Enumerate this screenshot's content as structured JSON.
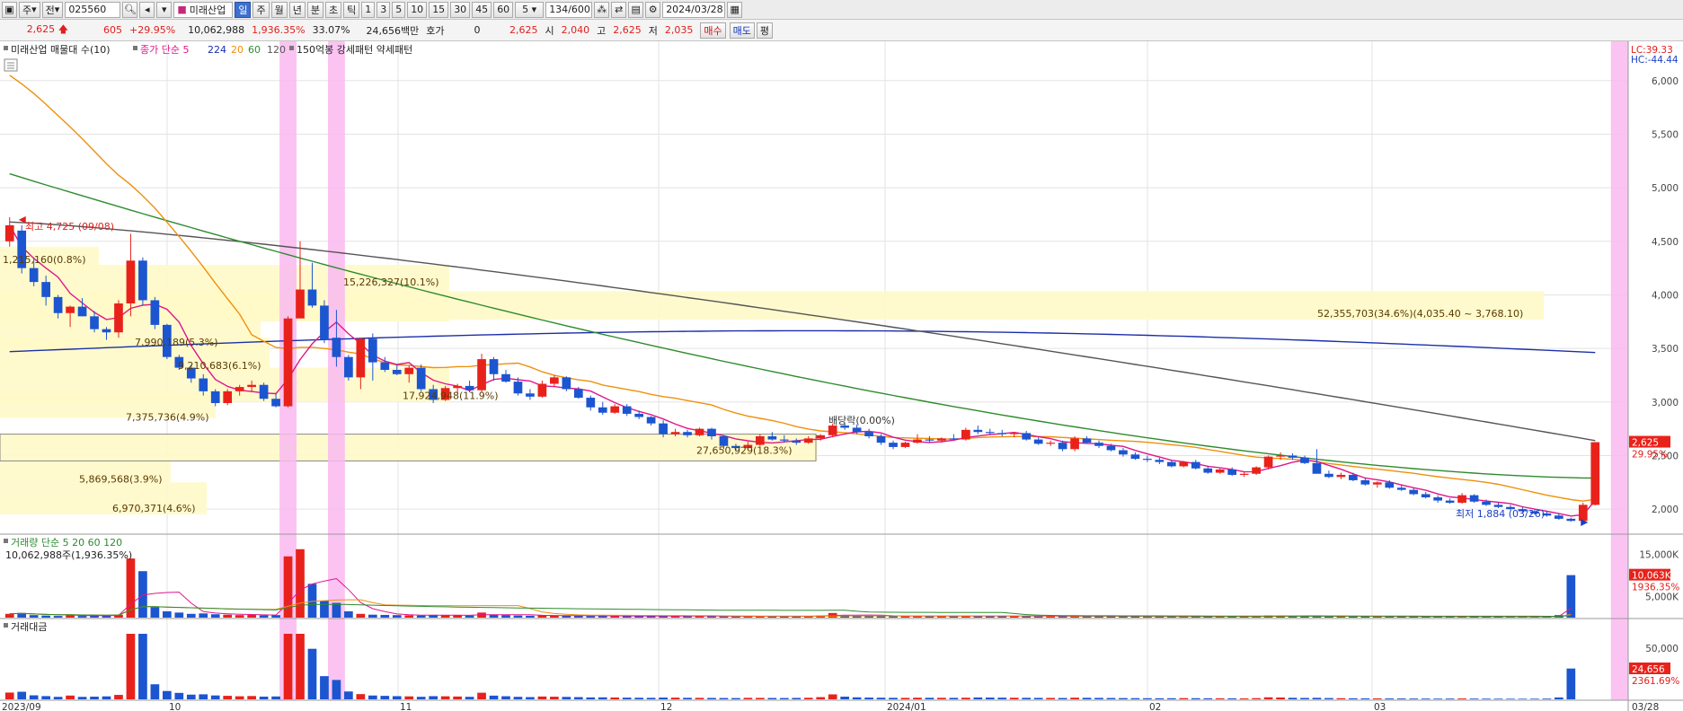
{
  "toolbar": {
    "items": [
      "주",
      "전"
    ],
    "code": "025560",
    "name": "미래산업",
    "periods": [
      "일",
      "주",
      "월",
      "년",
      "분",
      "초",
      "틱"
    ],
    "active_period": "일",
    "intervals": [
      "1",
      "3",
      "5",
      "10",
      "15",
      "30",
      "45",
      "60"
    ],
    "count_sel": "5",
    "range": "134",
    "range_total": "/600",
    "date": "2024/03/28"
  },
  "quote": {
    "price": "2,625",
    "change": "605",
    "change_pct": "+29.95%",
    "volume": "10,062,988",
    "volume_ratio": "1,936.35%",
    "turnover": "33.07%",
    "amount": "24,656백만",
    "ask_label": "호가",
    "ask_value": "0",
    "last": "2,625",
    "open_label": "시",
    "open": "2,040",
    "high_label": "고",
    "high": "2,625",
    "low_label": "저",
    "low": "2,035",
    "buy": "매수",
    "sell": "매도",
    "eval": "평"
  },
  "colors": {
    "up": "#e8221b",
    "down": "#1c55d0",
    "ma5": "#e0168a",
    "ma20": "#f0900c",
    "ma60": "#2e8b2e",
    "ma120": "#555555",
    "ma224": "#1b2fa8",
    "highlight": "#f9b9f0",
    "box": "#fff9c8"
  },
  "price_pane": {
    "title": "미래산업 매물대 수(10)",
    "legend": [
      "종가 단순 5",
      "224",
      "20",
      "60",
      "120"
    ],
    "legend2": "150억봉 강세패턴 약세패턴",
    "lc": "LC:39.33",
    "hc": "HC:-44.44",
    "y_labels": [
      "6,000",
      "5,500",
      "5,000",
      "4,500",
      "4,000",
      "3,500",
      "3,000",
      "2,500",
      "2,000"
    ],
    "last_tag": "2,625",
    "pct_tag": "29.95%",
    "high_note": "최고 4,725 (09/08)",
    "low_note": "최저 1,884 (03/26)",
    "div_note": "배당락(0.00%)",
    "volume_profile": [
      "52,355,703(34.6%)(4,035.40 ~ 3,768.10)",
      "15,226,327(10.1%)",
      "7,990,189(5.3%)",
      "9,210,683(6.1%)",
      "17,924,948(11.9%)",
      "7,375,736(4.9%)",
      "27,650,929(18.3%)",
      "5,869,568(3.9%)",
      "6,970,371(4.6%)",
      "1,215,160(0.8%)"
    ]
  },
  "volume_pane": {
    "title": "거래량 단순 5 20 60 120",
    "value": "10,062,988주(1,936.35%)",
    "y_labels": [
      "15,000K",
      "5,000K"
    ],
    "tag": "10,063K",
    "tag2": "1936.35%"
  },
  "amount_pane": {
    "title": "거래대금",
    "y_labels": [
      "50,000"
    ],
    "tag": "24,656",
    "tag2": "2361.69%"
  },
  "x_labels": [
    "2023/09",
    "10",
    "11",
    "12",
    "2024/01",
    "02",
    "03",
    "03/28"
  ],
  "chart_data": {
    "type": "candlestick",
    "title": "미래산업",
    "y_range": [
      1800,
      6300
    ],
    "candles_ohlc": [
      [
        4500,
        4725,
        4450,
        4650
      ],
      [
        4600,
        4650,
        4200,
        4250
      ],
      [
        4250,
        4350,
        4080,
        4120
      ],
      [
        4120,
        4180,
        3900,
        3980
      ],
      [
        3980,
        4000,
        3780,
        3830
      ],
      [
        3830,
        3900,
        3700,
        3890
      ],
      [
        3890,
        3970,
        3800,
        3800
      ],
      [
        3800,
        3850,
        3650,
        3680
      ],
      [
        3680,
        3700,
        3580,
        3650
      ],
      [
        3650,
        3950,
        3600,
        3920
      ],
      [
        3920,
        4570,
        3800,
        4320
      ],
      [
        4320,
        4350,
        3900,
        3950
      ],
      [
        3950,
        3980,
        3680,
        3720
      ],
      [
        3720,
        3730,
        3400,
        3420
      ],
      [
        3420,
        3440,
        3300,
        3320
      ],
      [
        3320,
        3350,
        3180,
        3220
      ],
      [
        3220,
        3260,
        3060,
        3100
      ],
      [
        3100,
        3120,
        2960,
        2990
      ],
      [
        2990,
        3120,
        2970,
        3100
      ],
      [
        3100,
        3160,
        3060,
        3140
      ],
      [
        3140,
        3200,
        3090,
        3160
      ],
      [
        3160,
        3180,
        3010,
        3030
      ],
      [
        3030,
        3080,
        2950,
        2960
      ],
      [
        2960,
        3800,
        2950,
        3780
      ],
      [
        3780,
        4500,
        3800,
        4050
      ],
      [
        4050,
        4300,
        3880,
        3900
      ],
      [
        3900,
        3950,
        3550,
        3580
      ],
      [
        3600,
        3860,
        3330,
        3420
      ],
      [
        3420,
        3440,
        3200,
        3230
      ],
      [
        3230,
        3600,
        3120,
        3590
      ],
      [
        3590,
        3640,
        3200,
        3370
      ],
      [
        3370,
        3420,
        3280,
        3300
      ],
      [
        3300,
        3350,
        3250,
        3260
      ],
      [
        3260,
        3340,
        3180,
        3320
      ],
      [
        3320,
        3350,
        3100,
        3120
      ],
      [
        3120,
        3160,
        2990,
        3020
      ],
      [
        3020,
        3150,
        3010,
        3130
      ],
      [
        3130,
        3170,
        3080,
        3150
      ],
      [
        3150,
        3200,
        3090,
        3110
      ],
      [
        3110,
        3450,
        3090,
        3400
      ],
      [
        3400,
        3420,
        3200,
        3260
      ],
      [
        3260,
        3300,
        3180,
        3190
      ],
      [
        3190,
        3230,
        3060,
        3080
      ],
      [
        3080,
        3120,
        3020,
        3050
      ],
      [
        3050,
        3200,
        3040,
        3170
      ],
      [
        3170,
        3250,
        3140,
        3230
      ],
      [
        3230,
        3240,
        3100,
        3120
      ],
      [
        3120,
        3140,
        3030,
        3040
      ],
      [
        3040,
        3060,
        2920,
        2950
      ],
      [
        2950,
        3000,
        2880,
        2900
      ],
      [
        2900,
        2980,
        2890,
        2960
      ],
      [
        2960,
        2980,
        2870,
        2890
      ],
      [
        2890,
        2920,
        2840,
        2860
      ],
      [
        2860,
        2870,
        2780,
        2800
      ],
      [
        2800,
        2830,
        2670,
        2700
      ],
      [
        2700,
        2750,
        2680,
        2720
      ],
      [
        2720,
        2740,
        2670,
        2690
      ],
      [
        2690,
        2760,
        2680,
        2750
      ],
      [
        2750,
        2760,
        2650,
        2680
      ],
      [
        2680,
        2690,
        2560,
        2590
      ],
      [
        2590,
        2610,
        2540,
        2570
      ],
      [
        2570,
        2630,
        2560,
        2600
      ],
      [
        2600,
        2700,
        2590,
        2680
      ],
      [
        2680,
        2720,
        2640,
        2650
      ],
      [
        2650,
        2690,
        2620,
        2640
      ],
      [
        2640,
        2660,
        2600,
        2620
      ],
      [
        2620,
        2680,
        2610,
        2660
      ],
      [
        2660,
        2700,
        2640,
        2690
      ],
      [
        2690,
        2800,
        2670,
        2780
      ],
      [
        2780,
        2800,
        2740,
        2760
      ],
      [
        2760,
        2790,
        2700,
        2720
      ],
      [
        2720,
        2750,
        2660,
        2680
      ],
      [
        2680,
        2700,
        2600,
        2620
      ],
      [
        2620,
        2640,
        2560,
        2580
      ],
      [
        2580,
        2630,
        2570,
        2620
      ],
      [
        2620,
        2700,
        2610,
        2650
      ],
      [
        2650,
        2680,
        2620,
        2640
      ],
      [
        2640,
        2670,
        2620,
        2660
      ],
      [
        2660,
        2700,
        2640,
        2650
      ],
      [
        2650,
        2760,
        2640,
        2740
      ],
      [
        2740,
        2780,
        2700,
        2720
      ],
      [
        2720,
        2750,
        2690,
        2710
      ],
      [
        2710,
        2740,
        2680,
        2700
      ],
      [
        2700,
        2720,
        2670,
        2710
      ],
      [
        2710,
        2730,
        2640,
        2650
      ],
      [
        2650,
        2670,
        2600,
        2610
      ],
      [
        2610,
        2640,
        2590,
        2620
      ],
      [
        2620,
        2640,
        2540,
        2560
      ],
      [
        2560,
        2680,
        2540,
        2660
      ],
      [
        2660,
        2680,
        2610,
        2620
      ],
      [
        2620,
        2640,
        2570,
        2590
      ],
      [
        2590,
        2610,
        2540,
        2550
      ],
      [
        2550,
        2570,
        2490,
        2510
      ],
      [
        2510,
        2530,
        2460,
        2470
      ],
      [
        2470,
        2500,
        2440,
        2460
      ],
      [
        2460,
        2480,
        2420,
        2440
      ],
      [
        2440,
        2460,
        2390,
        2400
      ],
      [
        2400,
        2450,
        2390,
        2440
      ],
      [
        2440,
        2460,
        2370,
        2380
      ],
      [
        2380,
        2400,
        2330,
        2340
      ],
      [
        2340,
        2380,
        2330,
        2370
      ],
      [
        2370,
        2390,
        2310,
        2320
      ],
      [
        2320,
        2350,
        2300,
        2330
      ],
      [
        2330,
        2400,
        2320,
        2390
      ],
      [
        2390,
        2500,
        2370,
        2490
      ],
      [
        2490,
        2530,
        2460,
        2500
      ],
      [
        2500,
        2520,
        2460,
        2480
      ],
      [
        2480,
        2500,
        2420,
        2430
      ],
      [
        2430,
        2560,
        2420,
        2330
      ],
      [
        2330,
        2360,
        2290,
        2300
      ],
      [
        2300,
        2340,
        2280,
        2320
      ],
      [
        2320,
        2340,
        2260,
        2270
      ],
      [
        2270,
        2290,
        2220,
        2230
      ],
      [
        2230,
        2260,
        2200,
        2250
      ],
      [
        2250,
        2270,
        2190,
        2200
      ],
      [
        2200,
        2230,
        2170,
        2180
      ],
      [
        2180,
        2200,
        2130,
        2140
      ],
      [
        2140,
        2160,
        2100,
        2110
      ],
      [
        2110,
        2130,
        2060,
        2080
      ],
      [
        2080,
        2100,
        2050,
        2060
      ],
      [
        2060,
        2150,
        2050,
        2130
      ],
      [
        2130,
        2140,
        2060,
        2070
      ],
      [
        2070,
        2090,
        2030,
        2040
      ],
      [
        2040,
        2060,
        2010,
        2020
      ],
      [
        2020,
        2040,
        1990,
        2000
      ],
      [
        2000,
        2020,
        1970,
        1980
      ],
      [
        1980,
        2000,
        1950,
        1960
      ],
      [
        1960,
        1980,
        1930,
        1940
      ],
      [
        1940,
        1960,
        1900,
        1910
      ],
      [
        1910,
        1920,
        1884,
        1890
      ],
      [
        1890,
        2060,
        1884,
        2040
      ],
      [
        2040,
        2625,
        2035,
        2625
      ]
    ],
    "volume_k": [
      900,
      1100,
      600,
      500,
      400,
      600,
      400,
      450,
      500,
      700,
      14000,
      11000,
      2500,
      1500,
      1200,
      900,
      1000,
      800,
      700,
      600,
      650,
      550,
      600,
      14500,
      16200,
      8000,
      4000,
      3500,
      1500,
      900,
      700,
      650,
      600,
      550,
      500,
      650,
      600,
      550,
      500,
      1200,
      700,
      600,
      500,
      450,
      550,
      500,
      480,
      450,
      400,
      420,
      380,
      360,
      340,
      330,
      400,
      380,
      350,
      330,
      320,
      310,
      300,
      350,
      330,
      310,
      300,
      330,
      360,
      500,
      1100,
      600,
      450,
      400,
      380,
      360,
      340,
      380,
      360,
      350,
      340,
      360,
      420,
      400,
      380,
      360,
      350,
      340,
      330,
      320,
      380,
      360,
      340,
      320,
      300,
      290,
      280,
      270,
      280,
      300,
      290,
      280,
      270,
      260,
      250,
      300,
      500,
      450,
      380,
      350,
      400,
      340,
      300,
      280,
      270,
      260,
      250,
      240,
      230,
      220,
      210,
      230,
      250,
      220,
      210,
      200,
      190,
      180,
      200,
      230,
      600,
      10063
    ],
    "highlight_bars": [
      23,
      27,
      133
    ]
  }
}
